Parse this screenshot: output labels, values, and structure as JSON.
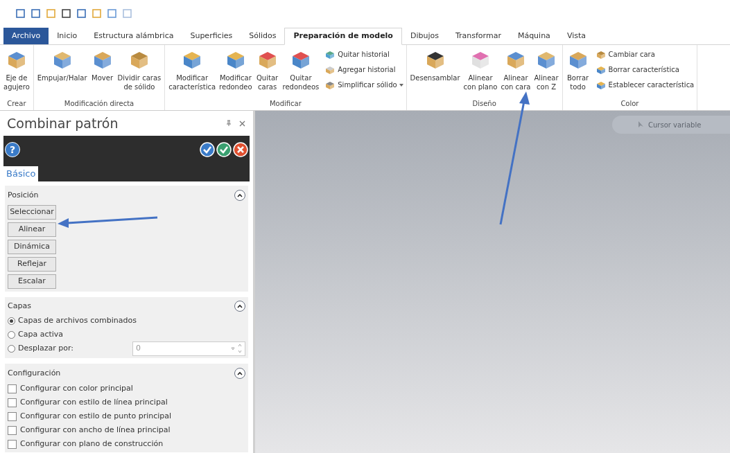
{
  "ribbon_tabs": [
    {
      "label": "Archivo",
      "selected": false,
      "kind": "file"
    },
    {
      "label": "Inicio",
      "selected": false,
      "kind": "tab"
    },
    {
      "label": "Estructura alámbrica",
      "selected": false,
      "kind": "tab"
    },
    {
      "label": "Superficies",
      "selected": false,
      "kind": "tab"
    },
    {
      "label": "Sólidos",
      "selected": false,
      "kind": "tab"
    },
    {
      "label": "Preparación de modelo",
      "selected": true,
      "kind": "tab"
    },
    {
      "label": "Dibujos",
      "selected": false,
      "kind": "tab"
    },
    {
      "label": "Transformar",
      "selected": false,
      "kind": "tab"
    },
    {
      "label": "Máquina",
      "selected": false,
      "kind": "tab"
    },
    {
      "label": "Vista",
      "selected": false,
      "kind": "tab"
    }
  ],
  "ribbon_groups": [
    {
      "title": "Crear",
      "large": [
        {
          "lines": [
            "Eje de",
            "agujero"
          ]
        }
      ]
    },
    {
      "title": "Modificación directa",
      "large": [
        {
          "lines": [
            "Empujar/Halar"
          ]
        },
        {
          "lines": [
            "Mover"
          ]
        },
        {
          "lines": [
            "Dividir caras",
            "de sólido"
          ]
        }
      ]
    },
    {
      "title": "Modificar",
      "large": [
        {
          "lines": [
            "Modificar",
            "característica"
          ]
        },
        {
          "lines": [
            "Modificar",
            "redondeo"
          ]
        },
        {
          "lines": [
            "Quitar",
            "caras"
          ]
        },
        {
          "lines": [
            "Quitar",
            "redondeos"
          ]
        }
      ],
      "small": [
        {
          "label": "Quitar historial",
          "dropdown": false
        },
        {
          "label": "Agregar historial",
          "dropdown": false
        },
        {
          "label": "Simplificar sólido",
          "dropdown": true
        }
      ]
    },
    {
      "title": "Diseño",
      "large": [
        {
          "lines": [
            "Desensamblar"
          ]
        },
        {
          "lines": [
            "Alinear",
            "con plano"
          ]
        },
        {
          "lines": [
            "Alinear",
            "con cara"
          ]
        },
        {
          "lines": [
            "Alinear",
            "con Z"
          ]
        }
      ]
    },
    {
      "title": "Color",
      "large": [
        {
          "lines": [
            "Borrar",
            "todo"
          ]
        }
      ],
      "small": [
        {
          "label": "Cambiar cara",
          "dropdown": false
        },
        {
          "label": "Borrar característica",
          "dropdown": false
        },
        {
          "label": "Establecer característica",
          "dropdown": false
        }
      ]
    }
  ],
  "panel": {
    "title": "Combinar patrón",
    "help_label": "?",
    "tabs": [
      {
        "label": "Básico",
        "selected": true
      }
    ],
    "position": {
      "title": "Posición",
      "expanded": true,
      "buttons": [
        "Seleccionar",
        "Alinear",
        "Dinámica",
        "Reflejar",
        "Escalar"
      ]
    },
    "layers": {
      "title": "Capas",
      "expanded": true,
      "options": [
        {
          "label": "Capas de archivos combinados",
          "selected": true
        },
        {
          "label": "Capa activa",
          "selected": false
        },
        {
          "label": "Desplazar por:",
          "selected": false
        }
      ],
      "offset_value": "0"
    },
    "configuration": {
      "title": "Configuración",
      "expanded": true,
      "options": [
        {
          "label": "Configurar con color principal",
          "checked": false
        },
        {
          "label": "Configurar con estilo de línea principal",
          "checked": false
        },
        {
          "label": "Configurar con estilo de punto principal",
          "checked": false
        },
        {
          "label": "Configurar con ancho de línea principal",
          "checked": false
        },
        {
          "label": "Configurar con plano de construcción",
          "checked": false
        }
      ]
    }
  },
  "viewport": {
    "cursor_mode": "Cursor variable"
  }
}
